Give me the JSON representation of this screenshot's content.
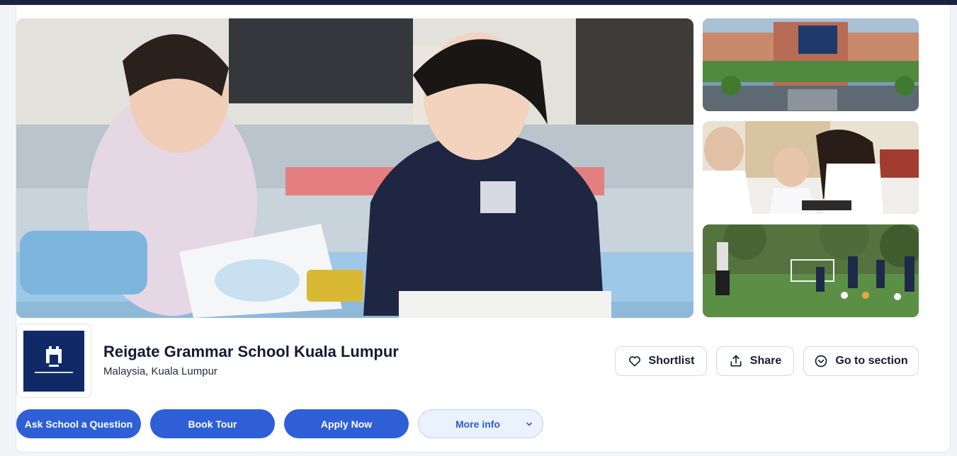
{
  "school": {
    "name": "Reigate Grammar School Kuala Lumpur",
    "location": "Malaysia, Kuala Lumpur"
  },
  "actions": {
    "shortlist": "Shortlist",
    "share": "Share",
    "go_to_section": "Go to section"
  },
  "cta": {
    "ask": "Ask School a Question",
    "tour": "Book Tour",
    "apply": "Apply Now",
    "more": "More info"
  },
  "colors": {
    "primary": "#2f5fd6",
    "brand_navy": "#0f2a66",
    "secondary_bg": "#eaf2fd"
  }
}
